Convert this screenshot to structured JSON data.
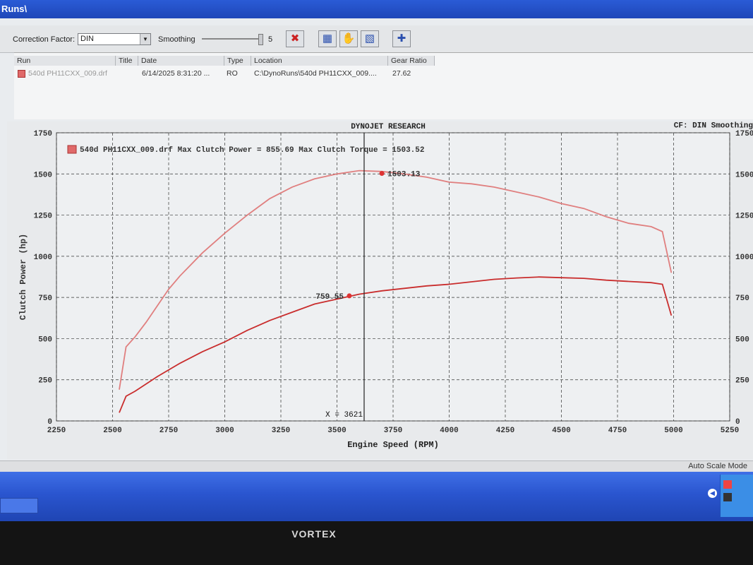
{
  "window": {
    "title": "Runs\\"
  },
  "toolbar": {
    "correction_label": "Correction Factor:",
    "correction_value": "DIN",
    "smoothing_label": "Smoothing",
    "smoothing_value": "5"
  },
  "runs_table": {
    "headers": [
      "Run",
      "Title",
      "Date",
      "Type",
      "Location",
      "Gear Ratio"
    ],
    "rows": [
      {
        "run": "540d PH11CXX_009.drf",
        "title": "",
        "date": "6/14/2025 8:31:20 ...",
        "type": "RO",
        "location": "C:\\DynoRuns\\540d PH11CXX_009....",
        "gear_ratio": "27.62",
        "color": "#e06a6a"
      }
    ]
  },
  "graph": {
    "header": "DYNOJET RESEARCH",
    "cf_text": "CF: DIN  Smoothing",
    "legend": "540d PH11CXX_009.drf Max Clutch Power = 855.69 Max Clutch Torque = 1503.52",
    "peak_torque_label": "1503.13",
    "power_label": "759.55",
    "cursor_label": "X = 3621"
  },
  "chart_data": {
    "type": "line",
    "title": "DYNOJET RESEARCH",
    "xlabel": "Engine Speed (RPM)",
    "ylabel": "Clutch Power (hp)",
    "xlim": [
      2250,
      5250
    ],
    "ylim": [
      0,
      1750
    ],
    "x_ticks": [
      2250,
      2500,
      2750,
      3000,
      3250,
      3500,
      3750,
      4000,
      4250,
      4500,
      4750,
      5000,
      5250
    ],
    "y_ticks": [
      0,
      250,
      500,
      750,
      1000,
      1250,
      1500,
      1750
    ],
    "y2_ticks": [
      0,
      250,
      500,
      750,
      1000,
      1250,
      1500,
      1750
    ],
    "cursor_x": 3621,
    "series": [
      {
        "name": "540d PH11CXX_009.drf",
        "kind": "torque",
        "color": "#e07f7f",
        "x": [
          2530,
          2560,
          2600,
          2650,
          2700,
          2750,
          2800,
          2900,
          3000,
          3100,
          3200,
          3300,
          3400,
          3500,
          3600,
          3700,
          3800,
          3900,
          4000,
          4100,
          4200,
          4300,
          4400,
          4500,
          4600,
          4700,
          4800,
          4900,
          4950,
          4990
        ],
        "y": [
          190,
          450,
          510,
          600,
          700,
          800,
          880,
          1020,
          1140,
          1250,
          1350,
          1420,
          1470,
          1500,
          1520,
          1515,
          1500,
          1480,
          1450,
          1440,
          1420,
          1390,
          1360,
          1320,
          1290,
          1240,
          1200,
          1180,
          1150,
          900
        ]
      },
      {
        "name": "540d PH11CXX_009.drf",
        "kind": "power",
        "color": "#c92d2d",
        "x": [
          2530,
          2560,
          2600,
          2700,
          2800,
          2900,
          3000,
          3100,
          3200,
          3300,
          3400,
          3500,
          3600,
          3700,
          3800,
          3900,
          4000,
          4100,
          4200,
          4300,
          4400,
          4500,
          4600,
          4700,
          4800,
          4900,
          4950,
          4990
        ],
        "y": [
          50,
          150,
          180,
          270,
          350,
          420,
          480,
          550,
          610,
          660,
          710,
          740,
          770,
          790,
          805,
          820,
          830,
          845,
          860,
          868,
          874,
          870,
          866,
          855,
          847,
          840,
          830,
          640
        ]
      }
    ],
    "markers": [
      {
        "x": 3700,
        "y": 1503.13
      },
      {
        "x": 3555,
        "y": 759.55
      }
    ]
  },
  "statusbar": {
    "mode": "Auto Scale Mode"
  },
  "monitor": {
    "brand": "VORTEX"
  }
}
